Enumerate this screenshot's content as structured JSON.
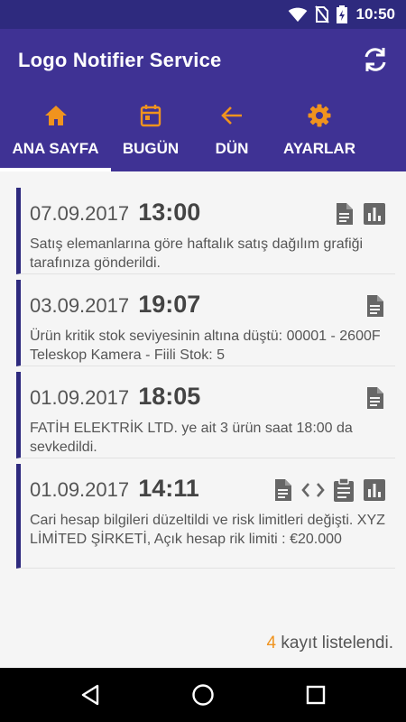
{
  "statusbar": {
    "time": "10:50",
    "icons": [
      "wifi-icon",
      "no-sim-icon",
      "battery-charging-icon"
    ]
  },
  "appbar": {
    "title": "Logo Notifier Service",
    "refresh_icon": "refresh-icon"
  },
  "tabs": [
    {
      "label": "ANA SAYFA",
      "icon": "home-icon",
      "selected": true
    },
    {
      "label": "BUGÜN",
      "icon": "calendar-icon",
      "selected": false
    },
    {
      "label": "DÜN",
      "icon": "arrow-back-icon",
      "selected": false
    },
    {
      "label": "AYARLAR",
      "icon": "gear-icon",
      "selected": false
    }
  ],
  "colors": {
    "primary": "#3f3294",
    "status_bar": "#2e2a7e",
    "accent": "#f0931e",
    "card_border": "#2e2a7e"
  },
  "notifications": [
    {
      "date": "07.09.2017",
      "time": "13:00",
      "message": "Satış elemanlarına göre haftalık satış dağılım grafiği tarafınıza gönderildi.",
      "actions": [
        "document-icon",
        "bar-chart-icon"
      ]
    },
    {
      "date": "03.09.2017",
      "time": "19:07",
      "message": "Ürün kritik stok seviyesinin altına düştü: 00001 - 2600F Teleskop Kamera - Fiili Stok: 5",
      "actions": [
        "document-icon"
      ]
    },
    {
      "date": "01.09.2017",
      "time": "18:05",
      "message": "FATİH ELEKTRİK LTD. ye ait 3 ürün saat 18:00 da sevkedildi.",
      "actions": [
        "document-icon"
      ]
    },
    {
      "date": "01.09.2017",
      "time": "14:11",
      "message": "Cari hesap bilgileri düzeltildi ve risk limitleri değişti. XYZ LİMİTED ŞİRKETİ, Açık hesap rik limiti : €20.000",
      "actions": [
        "document-icon",
        "code-icon",
        "clipboard-icon",
        "bar-chart-icon"
      ]
    }
  ],
  "footer": {
    "count": "4",
    "label": " kayıt listelendi."
  }
}
